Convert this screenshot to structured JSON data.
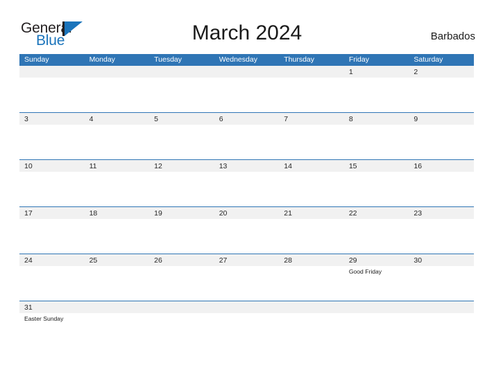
{
  "brand": {
    "word_one": "General",
    "word_two": "Blue",
    "logo_icon": "general-blue-triangle-logo",
    "accent_color": "#1b74bb"
  },
  "header": {
    "title": "March 2024",
    "country": "Barbados"
  },
  "theme": {
    "header_blue": "#2f75b5",
    "date_strip_gray": "#f1f1f1",
    "rule_blue": "#2f75b5",
    "text_dark": "#262626"
  },
  "calendar": {
    "weekdays": [
      "Sunday",
      "Monday",
      "Tuesday",
      "Wednesday",
      "Thursday",
      "Friday",
      "Saturday"
    ],
    "weeks": [
      {
        "days": [
          {
            "date": "",
            "event": ""
          },
          {
            "date": "",
            "event": ""
          },
          {
            "date": "",
            "event": ""
          },
          {
            "date": "",
            "event": ""
          },
          {
            "date": "",
            "event": ""
          },
          {
            "date": "1",
            "event": ""
          },
          {
            "date": "2",
            "event": ""
          }
        ]
      },
      {
        "days": [
          {
            "date": "3",
            "event": ""
          },
          {
            "date": "4",
            "event": ""
          },
          {
            "date": "5",
            "event": ""
          },
          {
            "date": "6",
            "event": ""
          },
          {
            "date": "7",
            "event": ""
          },
          {
            "date": "8",
            "event": ""
          },
          {
            "date": "9",
            "event": ""
          }
        ]
      },
      {
        "days": [
          {
            "date": "10",
            "event": ""
          },
          {
            "date": "11",
            "event": ""
          },
          {
            "date": "12",
            "event": ""
          },
          {
            "date": "13",
            "event": ""
          },
          {
            "date": "14",
            "event": ""
          },
          {
            "date": "15",
            "event": ""
          },
          {
            "date": "16",
            "event": ""
          }
        ]
      },
      {
        "days": [
          {
            "date": "17",
            "event": ""
          },
          {
            "date": "18",
            "event": ""
          },
          {
            "date": "19",
            "event": ""
          },
          {
            "date": "20",
            "event": ""
          },
          {
            "date": "21",
            "event": ""
          },
          {
            "date": "22",
            "event": ""
          },
          {
            "date": "23",
            "event": ""
          }
        ]
      },
      {
        "days": [
          {
            "date": "24",
            "event": ""
          },
          {
            "date": "25",
            "event": ""
          },
          {
            "date": "26",
            "event": ""
          },
          {
            "date": "27",
            "event": ""
          },
          {
            "date": "28",
            "event": ""
          },
          {
            "date": "29",
            "event": "Good Friday"
          },
          {
            "date": "30",
            "event": ""
          }
        ]
      },
      {
        "days": [
          {
            "date": "31",
            "event": "Easter Sunday"
          },
          {
            "date": "",
            "event": ""
          },
          {
            "date": "",
            "event": ""
          },
          {
            "date": "",
            "event": ""
          },
          {
            "date": "",
            "event": ""
          },
          {
            "date": "",
            "event": ""
          },
          {
            "date": "",
            "event": ""
          }
        ]
      }
    ]
  }
}
